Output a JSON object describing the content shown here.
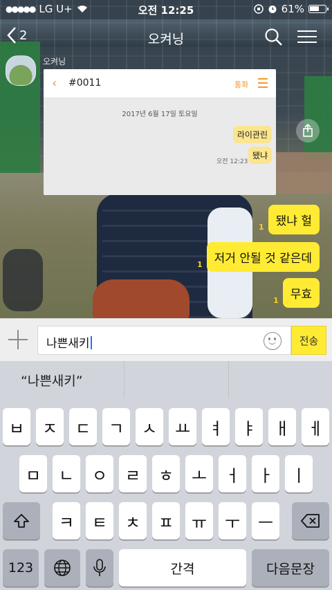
{
  "status_bar": {
    "carrier": "LG U+",
    "signal": "●●●●●",
    "time": "오전 12:25",
    "battery": "61%",
    "battery_level": 0.61
  },
  "header": {
    "back_count": "2",
    "title": "오켜닝"
  },
  "sender": {
    "name": "오켜닝"
  },
  "shared_image": {
    "title": "#0011",
    "call_label": "통화",
    "date": "2017년 6월 17일 토요일",
    "messages": [
      "라이관린",
      "됐냐"
    ],
    "time": "오전 12:23"
  },
  "messages": [
    {
      "text": "됐냐 헐",
      "unread": "1"
    },
    {
      "text": "저거 안될 것 같은데",
      "unread": "1"
    },
    {
      "text": "무효",
      "unread": "1"
    }
  ],
  "input": {
    "value": "나쁜새키",
    "send_label": "전송"
  },
  "suggestions": [
    "“나쁜새키”",
    "",
    ""
  ],
  "keyboard": {
    "row1": [
      "ㅂ",
      "ㅈ",
      "ㄷ",
      "ㄱ",
      "ㅅ",
      "ㅛ",
      "ㅕ",
      "ㅑ",
      "ㅐ",
      "ㅔ"
    ],
    "row2": [
      "ㅁ",
      "ㄴ",
      "ㅇ",
      "ㄹ",
      "ㅎ",
      "ㅗ",
      "ㅓ",
      "ㅏ",
      "ㅣ"
    ],
    "row3": [
      "ㅋ",
      "ㅌ",
      "ㅊ",
      "ㅍ",
      "ㅠ",
      "ㅜ",
      "ㅡ"
    ],
    "numbers_label": "123",
    "space_label": "간격",
    "return_label": "다음문장"
  }
}
